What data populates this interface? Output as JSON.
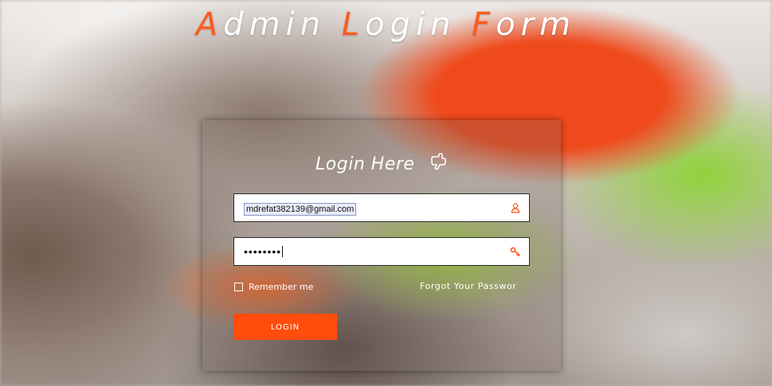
{
  "page": {
    "title_parts": [
      {
        "text": "A",
        "accent": true
      },
      {
        "text": "dmin ",
        "accent": false
      },
      {
        "text": "L",
        "accent": true
      },
      {
        "text": "ogin ",
        "accent": false
      },
      {
        "text": "F",
        "accent": true
      },
      {
        "text": "orm",
        "accent": false
      }
    ],
    "accent_color": "#ff5a1f"
  },
  "form": {
    "heading": "Login Here",
    "heading_icon": "pointing-hand-icon",
    "email": {
      "value": "mdrefat382139@gmail.com",
      "icon": "user-icon"
    },
    "password": {
      "masked_value": "••••••••",
      "icon": "key-icon"
    },
    "remember_label": "Remember me",
    "forgot_label": "Forgot Your Password?",
    "login_label": "LOGIN",
    "button_color": "#ff4d0d"
  }
}
